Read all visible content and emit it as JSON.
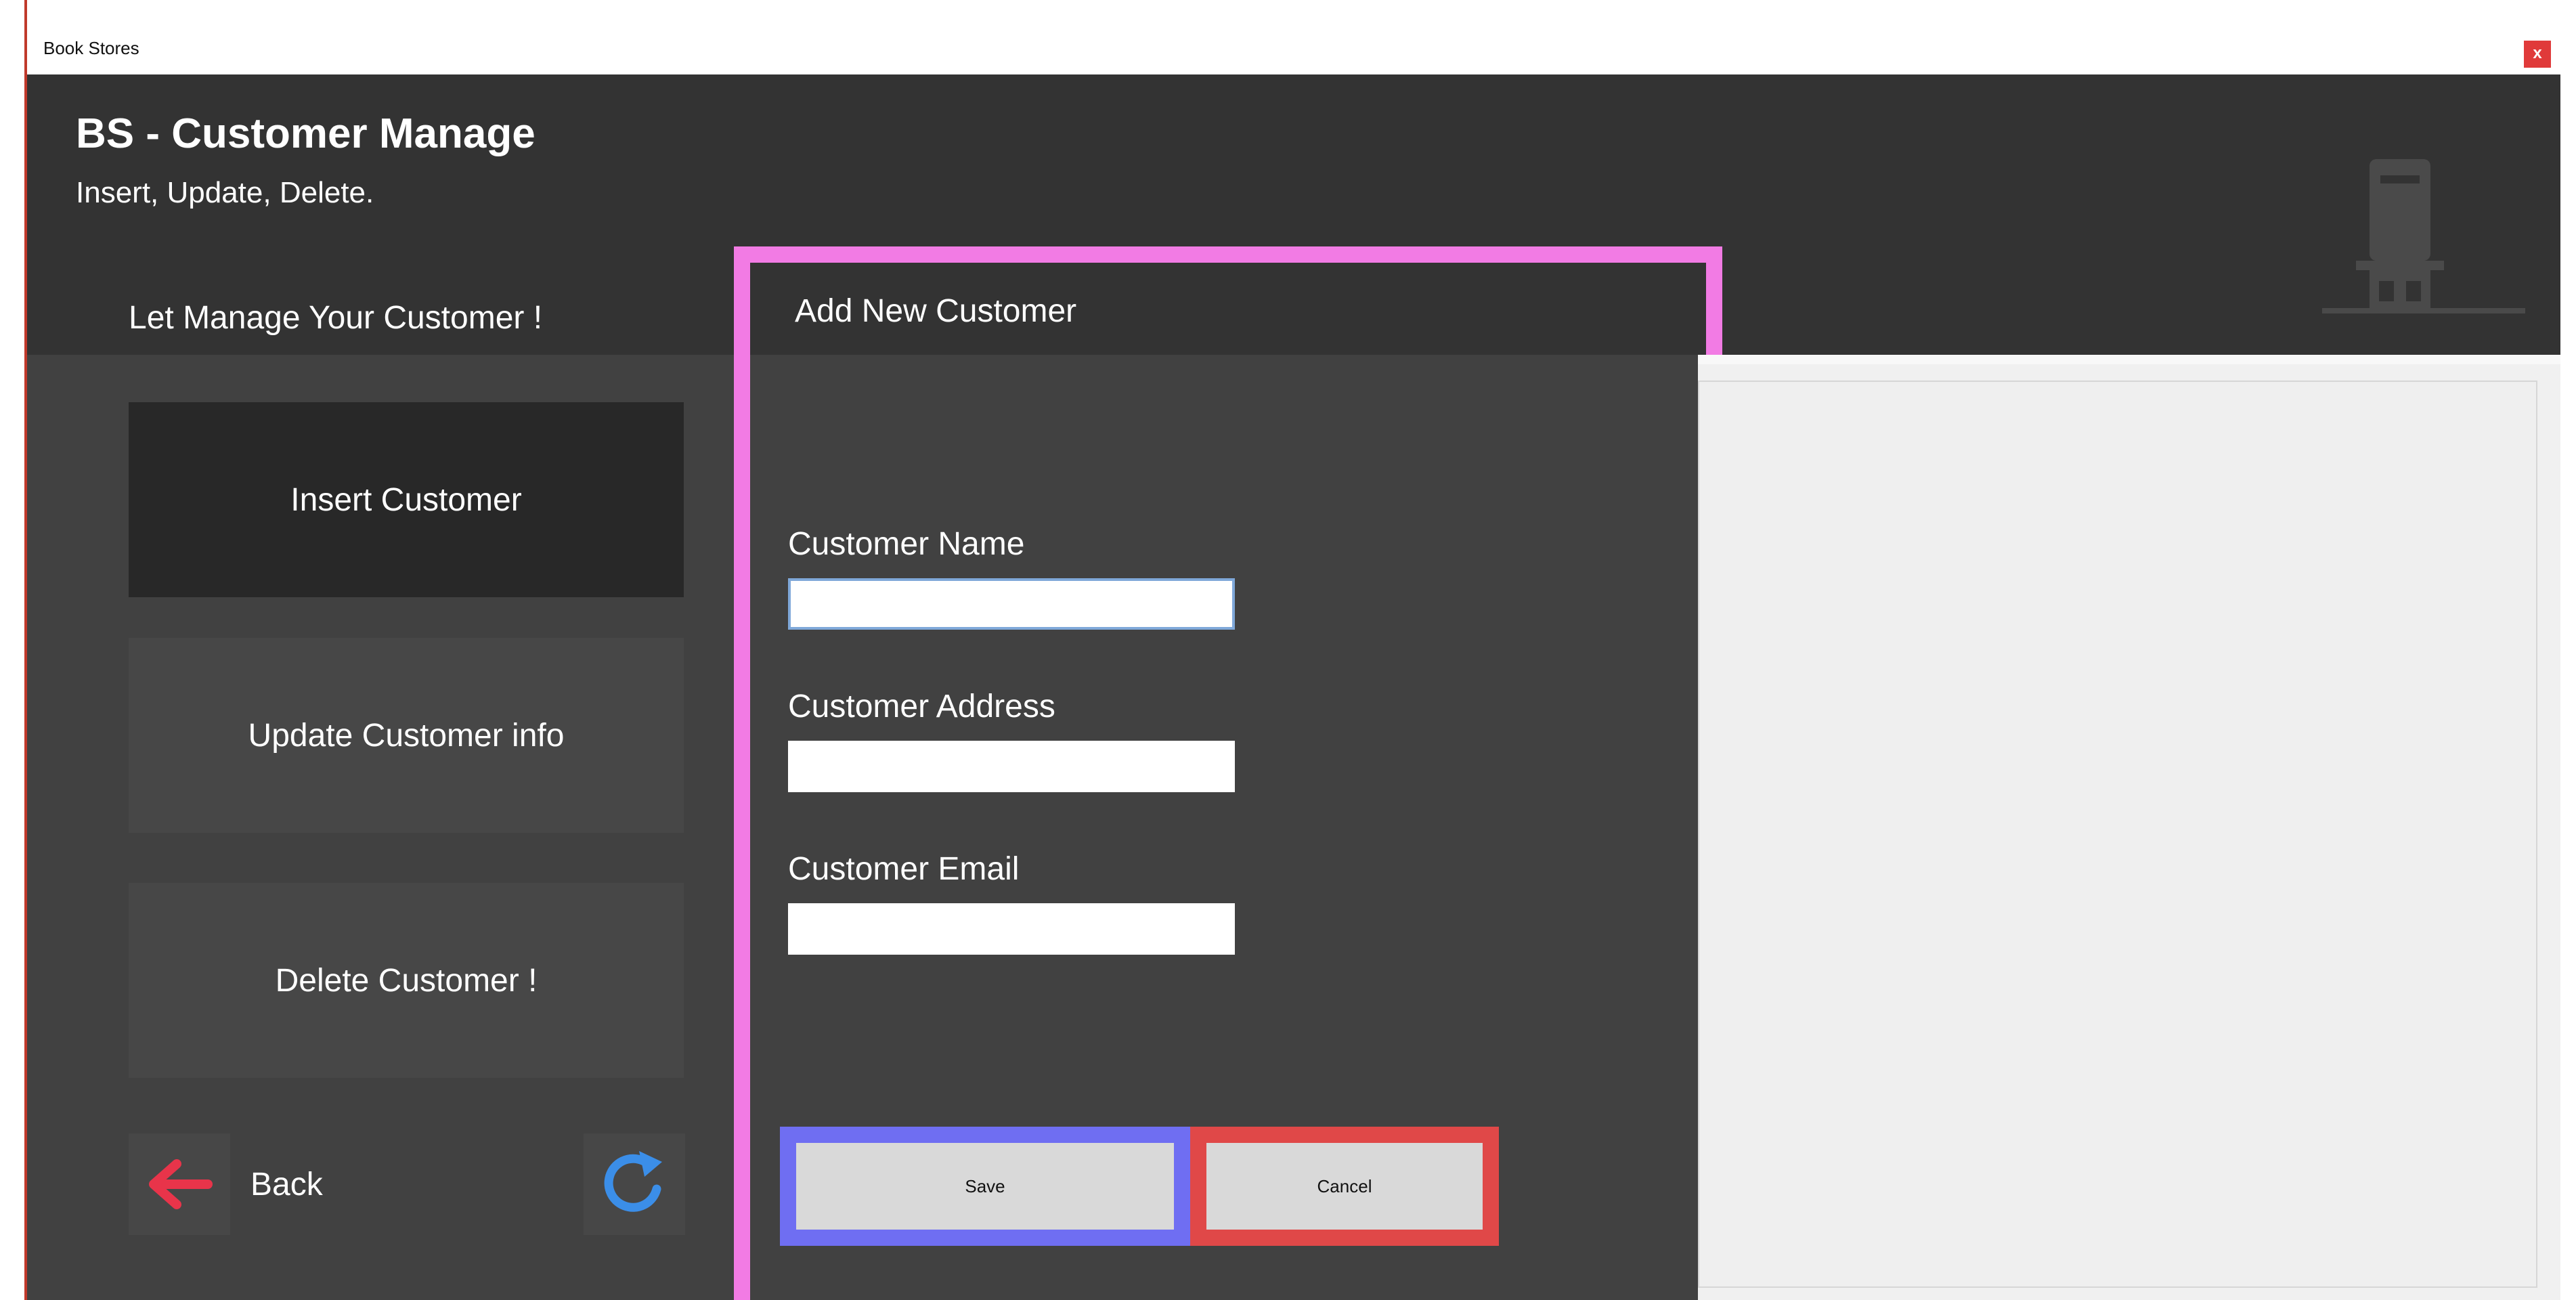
{
  "window": {
    "title": "Book Stores",
    "close_label": "x"
  },
  "header": {
    "title": "BS - Customer Manage",
    "subtitle": "Insert, Update, Delete."
  },
  "sidebar": {
    "heading": "Let Manage Your Customer !",
    "items": [
      {
        "label": "Insert Customer",
        "active": true
      },
      {
        "label": "Update Customer info",
        "active": false
      },
      {
        "label": "Delete Customer !",
        "active": false
      }
    ],
    "back_label": "Back"
  },
  "form": {
    "heading": "Add New Customer",
    "fields": [
      {
        "label": "Customer Name",
        "value": ""
      },
      {
        "label": "Customer Address",
        "value": ""
      },
      {
        "label": "Customer Email",
        "value": ""
      }
    ],
    "save_label": "Save",
    "cancel_label": "Cancel"
  },
  "colors": {
    "dark_bg": "#333333",
    "panel_bg": "#414141",
    "active_item": "#282828",
    "highlight_form": "#f27be4",
    "highlight_save": "#6f6ef2",
    "highlight_cancel": "#e04848",
    "back_arrow": "#e8344a",
    "refresh_icon": "#3b8ee8"
  },
  "icons": {
    "back": "arrow-left-icon",
    "refresh": "refresh-icon",
    "store": "store-icon"
  }
}
